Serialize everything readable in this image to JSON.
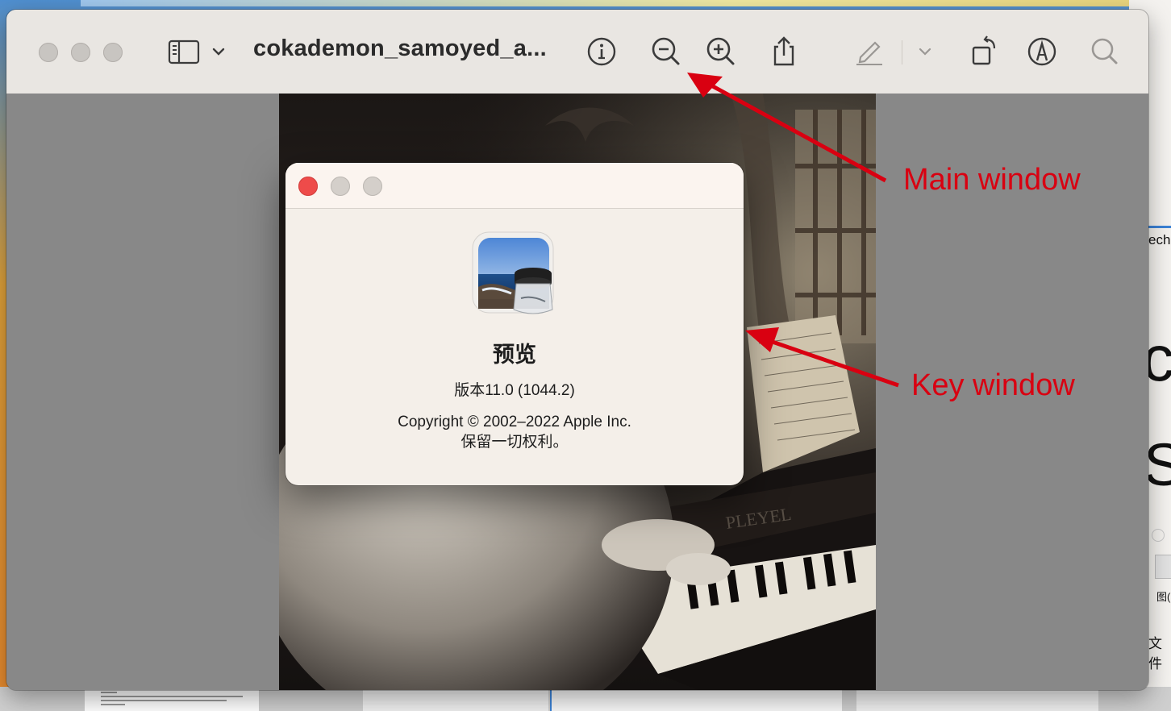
{
  "window": {
    "title": "cokademon_samoyed_a...",
    "toolbar": {
      "sidebar_icon": "sidebar-icon",
      "info_icon": "info-icon",
      "zoom_out_icon": "zoom-out-icon",
      "zoom_in_icon": "zoom-in-icon",
      "share_icon": "share-icon",
      "markup_icon": "markup-pencil-icon",
      "rotate_icon": "rotate-icon",
      "annotate_icon": "annotate-icon",
      "search_icon": "search-icon"
    }
  },
  "about": {
    "app_icon": "preview-app-icon",
    "app_name": "预览",
    "version": "版本11.0 (1044.2)",
    "copyright_line1": "Copyright © 2002–2022 Apple Inc.",
    "copyright_line2": "保留一切权利。"
  },
  "annotations": {
    "main": "Main window",
    "key": "Key window"
  },
  "background": {
    "right_text_1": "ech",
    "right_text_2": "c",
    "right_text_3": "S",
    "right_text_4": "图(",
    "right_text_5": "文件"
  },
  "colors": {
    "annotation_red": "#d90011",
    "close_red": "#ee4b4a",
    "toolbar_bg": "#e9e6e2",
    "dialog_bg": "#f4efe9"
  }
}
